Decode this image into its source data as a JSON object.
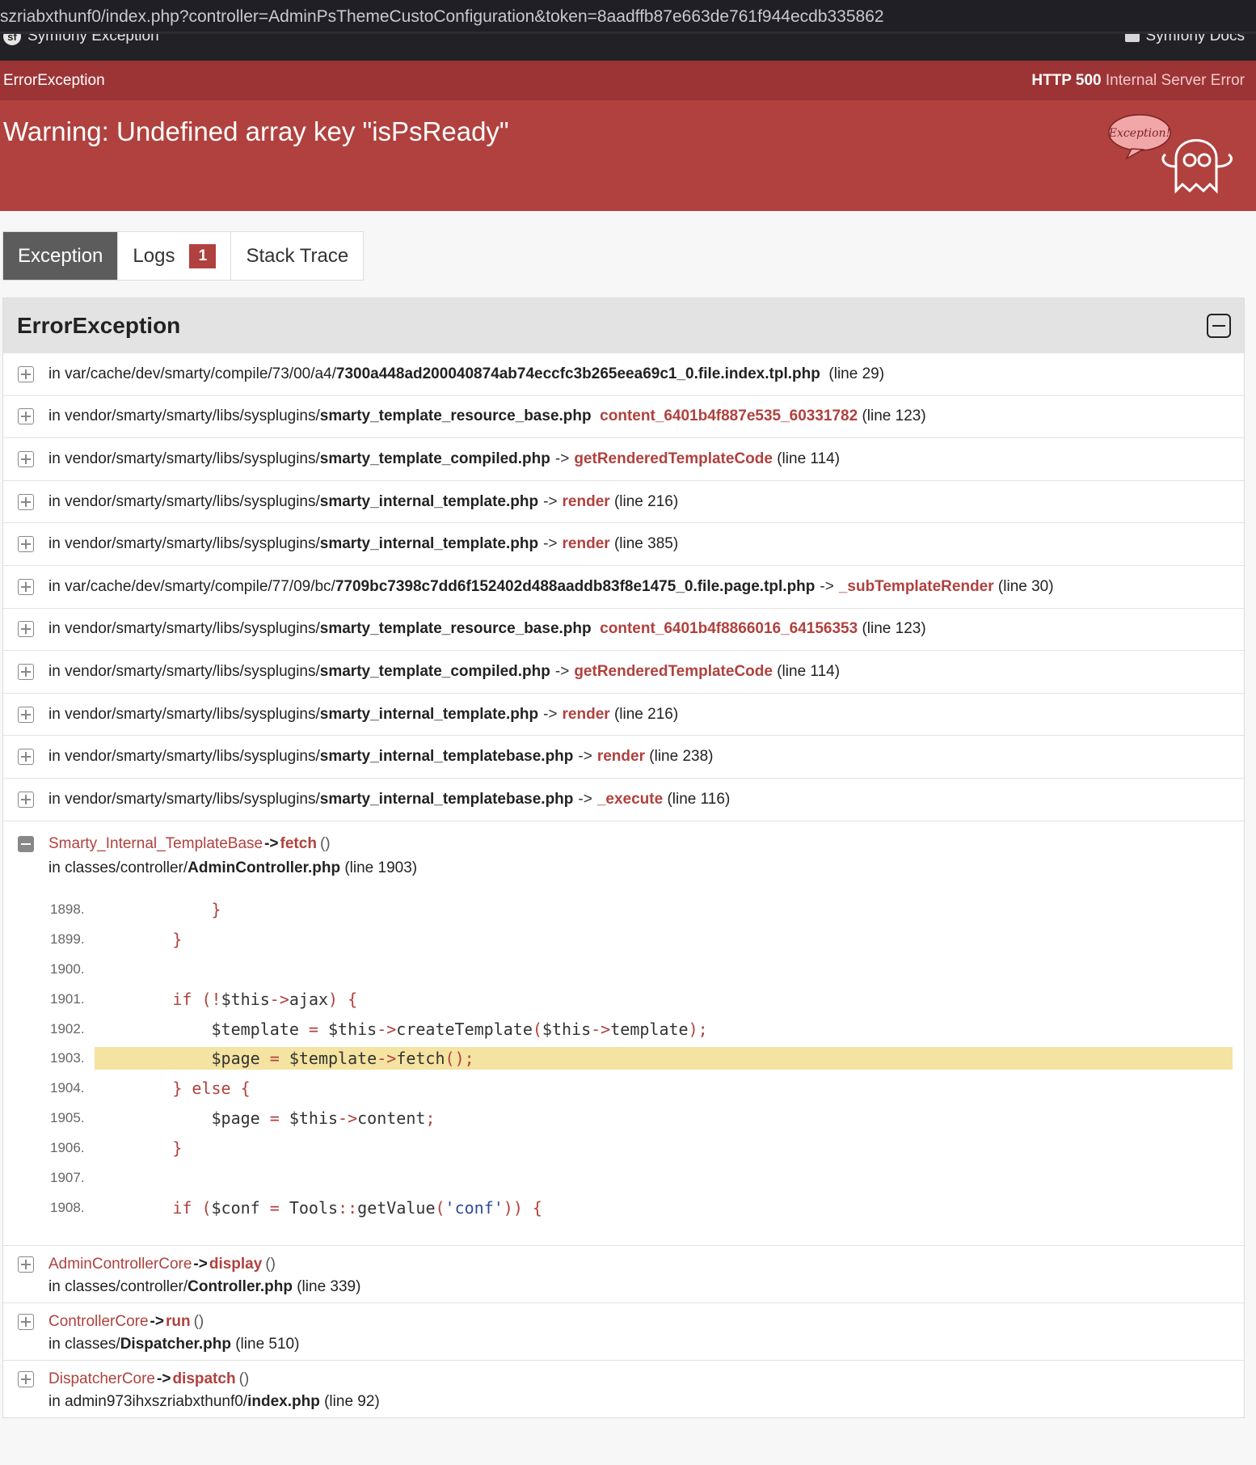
{
  "browser": {
    "url": "szriabxthunf0/index.php?controller=AdminPsThemeCustoConfiguration&token=8aadffb87e663de761f944ecdb335862"
  },
  "toolbar": {
    "left_label": "Symfony Exception",
    "right_label": "Symfony Docs"
  },
  "header": {
    "exception_class": "ErrorException",
    "http_code": "HTTP 500",
    "http_text": "Internal Server Error",
    "message": "Warning: Undefined array key \"isPsReady\"",
    "ghost_text": "Exception!"
  },
  "tabs": [
    {
      "label": "Exception"
    },
    {
      "label": "Logs",
      "badge": "1"
    },
    {
      "label": "Stack Trace"
    }
  ],
  "panel": {
    "title": "ErrorException"
  },
  "trace": [
    {
      "prefix": "in var/cache/dev/smarty/compile/73/00/a4/",
      "file": "7300a448ad200040874ab74eccfc3b265eea69c1_0.file.index.tpl.php",
      "arrow": "",
      "fn": "",
      "line": "(line 29)"
    },
    {
      "prefix": "in vendor/smarty/smarty/libs/sysplugins/",
      "file": "smarty_template_resource_base.php",
      "arrow": "",
      "fn": "content_6401b4f887e535_60331782",
      "line": "(line 123)"
    },
    {
      "prefix": "in vendor/smarty/smarty/libs/sysplugins/",
      "file": "smarty_template_compiled.php",
      "arrow": "->",
      "fn": "getRenderedTemplateCode",
      "line": "(line 114)"
    },
    {
      "prefix": "in vendor/smarty/smarty/libs/sysplugins/",
      "file": "smarty_internal_template.php",
      "arrow": "->",
      "fn": "render",
      "line": "(line 216)"
    },
    {
      "prefix": "in vendor/smarty/smarty/libs/sysplugins/",
      "file": "smarty_internal_template.php",
      "arrow": "->",
      "fn": "render",
      "line": "(line 385)"
    },
    {
      "prefix": "in var/cache/dev/smarty/compile/77/09/bc/",
      "file": "7709bc7398c7dd6f152402d488aaddb83f8e1475_0.file.page.tpl.php",
      "arrow": "->",
      "fn": "_subTemplateRender",
      "line": "(line 30)"
    },
    {
      "prefix": "in vendor/smarty/smarty/libs/sysplugins/",
      "file": "smarty_template_resource_base.php",
      "arrow": "",
      "fn": "content_6401b4f8866016_64156353",
      "line": "(line 123)"
    },
    {
      "prefix": "in vendor/smarty/smarty/libs/sysplugins/",
      "file": "smarty_template_compiled.php",
      "arrow": "->",
      "fn": "getRenderedTemplateCode",
      "line": "(line 114)"
    },
    {
      "prefix": "in vendor/smarty/smarty/libs/sysplugins/",
      "file": "smarty_internal_template.php",
      "arrow": "->",
      "fn": "render",
      "line": "(line 216)"
    },
    {
      "prefix": "in vendor/smarty/smarty/libs/sysplugins/",
      "file": "smarty_internal_templatebase.php",
      "arrow": "->",
      "fn": "render",
      "line": "(line 238)"
    },
    {
      "prefix": "in vendor/smarty/smarty/libs/sysplugins/",
      "file": "smarty_internal_templatebase.php",
      "arrow": "->",
      "fn": "_execute",
      "line": "(line 116)"
    }
  ],
  "expanded": {
    "cls": "Smarty_Internal_TemplateBase",
    "op": "->",
    "fn": "fetch",
    "paren": "()",
    "prefix": "in classes/controller/",
    "file": "AdminController.php",
    "line": "(line 1903)",
    "code": [
      {
        "num": "1898.",
        "src": "            }"
      },
      {
        "num": "1899.",
        "src": "        }"
      },
      {
        "num": "1900.",
        "src": ""
      },
      {
        "num": "1901.",
        "src": "        if (!$this->ajax) {"
      },
      {
        "num": "1902.",
        "src": "            $template = $this->createTemplate($this->template);"
      },
      {
        "num": "1903.",
        "src": "            $page = $template->fetch();",
        "highlight": true
      },
      {
        "num": "1904.",
        "src": "        } else {"
      },
      {
        "num": "1905.",
        "src": "            $page = $this->content;"
      },
      {
        "num": "1906.",
        "src": "        }"
      },
      {
        "num": "1907.",
        "src": ""
      },
      {
        "num": "1908.",
        "src": "        if ($conf = Tools::getValue('conf')) {"
      }
    ]
  },
  "calls": [
    {
      "cls": "AdminControllerCore",
      "op": "->",
      "fn": "display",
      "paren": "()",
      "prefix": "in classes/controller/",
      "file": "Controller.php",
      "line": "(line 339)"
    },
    {
      "cls": "ControllerCore",
      "op": "->",
      "fn": "run",
      "paren": "()",
      "prefix": "in classes/",
      "file": "Dispatcher.php",
      "line": "(line 510)"
    },
    {
      "cls": "DispatcherCore",
      "op": "->",
      "fn": "dispatch",
      "paren": "()",
      "prefix": "in admin973ihxszriabxthunf0/",
      "file": "index.php",
      "line": "(line 92)"
    }
  ]
}
